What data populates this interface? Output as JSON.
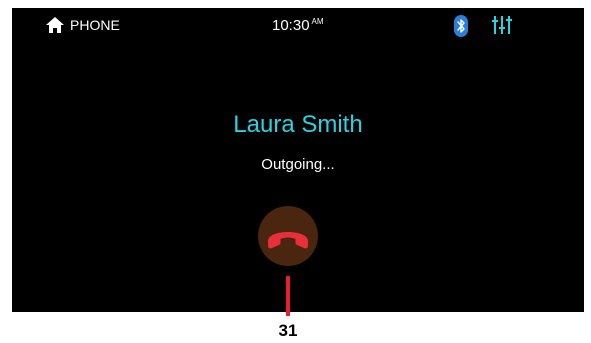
{
  "status_bar": {
    "home_icon": "home-icon",
    "app_label": "PHONE",
    "time": "10:30",
    "time_suffix": "AM",
    "bluetooth_icon": "bluetooth-icon",
    "equalizer_icon": "equalizer-icon"
  },
  "call": {
    "contact_name": "Laura Smith",
    "status": "Outgoing...",
    "end_call_icon": "hang-up-icon"
  },
  "callout": {
    "label": "31"
  },
  "colors": {
    "screen_bg": "#000000",
    "contact_name": "#29d3e0",
    "bluetooth": "#2a7fd6",
    "equalizer": "#29d3e0",
    "end_call_bg": "#4a2610",
    "end_call_icon": "#e8303a",
    "callout_line": "#e8202a"
  }
}
